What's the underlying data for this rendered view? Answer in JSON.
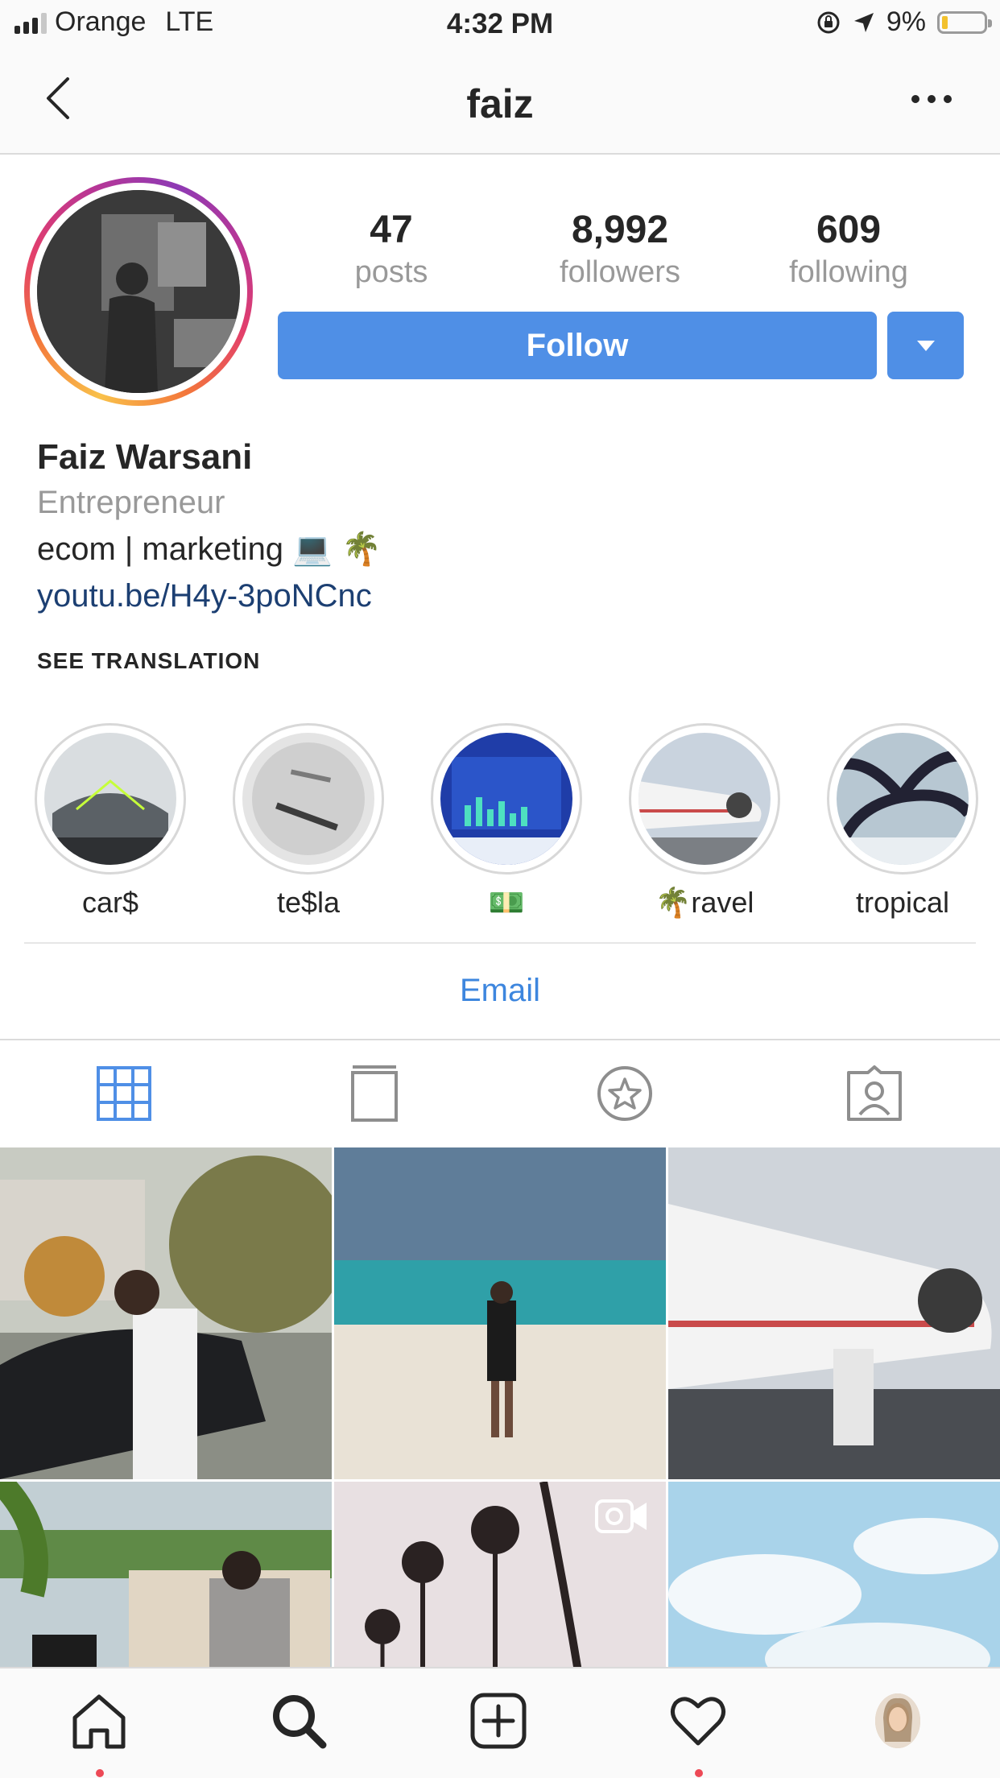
{
  "status_bar": {
    "carrier": "Orange",
    "network": "LTE",
    "time": "4:32 PM",
    "battery": "9%",
    "battery_level": 0.09
  },
  "nav": {
    "title": "faiz"
  },
  "profile": {
    "stats": [
      {
        "num": "47",
        "label": "posts"
      },
      {
        "num": "8,992",
        "label": "followers"
      },
      {
        "num": "609",
        "label": "following"
      }
    ],
    "follow_label": "Follow",
    "name": "Faiz Warsani",
    "category": "Entrepreneur",
    "bio": "ecom | marketing 💻 🌴",
    "link": "youtu.be/H4y-3poNCnc",
    "see_translation": "SEE TRANSLATION"
  },
  "highlights": [
    {
      "label": "car$"
    },
    {
      "label": "te$la"
    },
    {
      "label": "💵"
    },
    {
      "label": "🌴ravel"
    },
    {
      "label": "tropical"
    }
  ],
  "email_label": "Email",
  "tabs": [
    "grid-icon",
    "igtv-icon",
    "star-icon",
    "tagged-icon"
  ],
  "bottom_nav": [
    "home-icon",
    "search-icon",
    "add-icon",
    "heart-icon",
    "profile-avatar"
  ],
  "colors": {
    "accent": "#4f8fe6",
    "link": "#1c3f72",
    "email": "#3d86de",
    "notification_dot": "#ed4956"
  }
}
